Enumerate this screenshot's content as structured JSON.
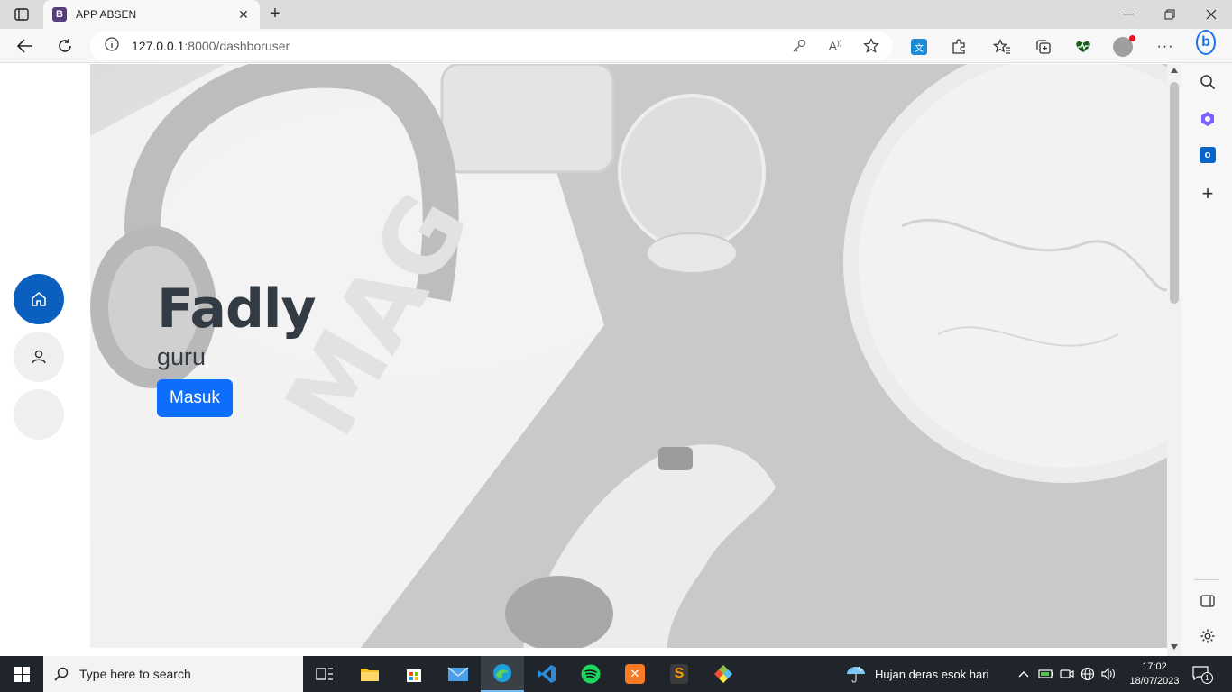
{
  "browser": {
    "tab_title": "APP ABSEN",
    "tab_favicon_letter": "B",
    "url_host": "127.0.0.1",
    "url_rest": ":8000/dashboruser"
  },
  "page": {
    "name": "Fadly",
    "role": "guru",
    "button_label": "Masuk"
  },
  "sidenav": {
    "items": [
      {
        "icon": "home-icon",
        "active": true
      },
      {
        "icon": "user-icon",
        "active": false
      },
      {
        "icon": "blank",
        "active": false
      }
    ]
  },
  "taskbar": {
    "search_placeholder": "Type here to search",
    "weather_text": "Hujan deras esok hari",
    "time": "17:02",
    "date": "18/07/2023",
    "notification_count": "1"
  },
  "colors": {
    "accent_blue": "#0d6efd",
    "nav_active": "#0a5fbf",
    "heading_text": "#333b45"
  }
}
